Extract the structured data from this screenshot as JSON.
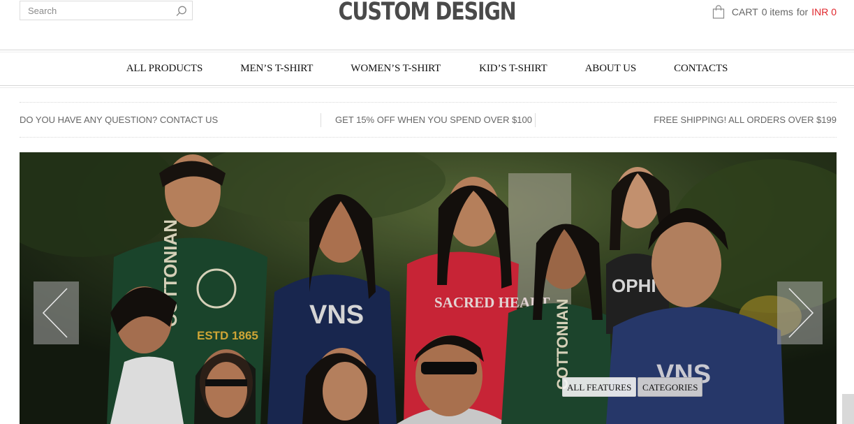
{
  "header": {
    "search_placeholder": "Search",
    "logo": "CUSTOM DESIGN",
    "cart": {
      "label": "CART",
      "items": "0 items",
      "for": "for",
      "amount": "INR 0"
    }
  },
  "nav": {
    "items": [
      {
        "label": "ALL PRODUCTS"
      },
      {
        "label": "MEN’S T-SHIRT"
      },
      {
        "label": "WOMEN’S T-SHIRT"
      },
      {
        "label": "KID’S T-SHIRT"
      },
      {
        "label": "ABOUT US"
      },
      {
        "label": "CONTACTS"
      }
    ]
  },
  "promo": {
    "left": "DO YOU HAVE ANY QUESTION? CONTACT US",
    "center": "GET 15% OFF WHEN YOU SPEND OVER $100",
    "right": "FREE SHIPPING! ALL ORDERS OVER $199"
  },
  "slider": {
    "shirt_prints": [
      "COTTONIAN",
      "ESTD 1865",
      "VNS",
      "SACRED HEART",
      "COTTONIAN",
      "OPHI",
      "VNS"
    ],
    "buttons": {
      "features": "ALL FEATURES",
      "categories": "CATEGORIES"
    },
    "arrows": {
      "prev": "chevron-left-icon",
      "next": "chevron-right-icon"
    }
  },
  "colors": {
    "accent": "#e0252b",
    "text": "#555555",
    "nav_text": "#111111",
    "slider_bg": "#1d2a16"
  }
}
